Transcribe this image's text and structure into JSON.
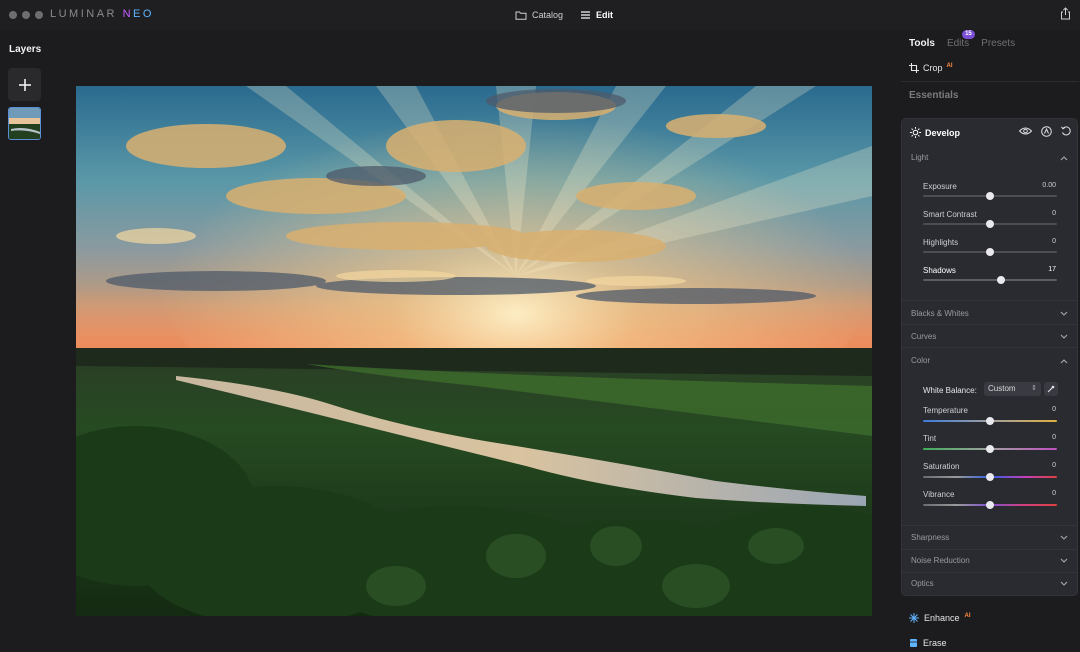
{
  "titlebar": {
    "brand_prefix": "LUMINAR",
    "brand_suffix": "NEO",
    "catalog_label": "Catalog",
    "edit_label": "Edit"
  },
  "left_panel": {
    "title": "Layers"
  },
  "right_panel": {
    "tabs": [
      {
        "label": "Tools",
        "active": true
      },
      {
        "label": "Edits",
        "active": false,
        "badge": "15"
      },
      {
        "label": "Presets",
        "active": false
      }
    ],
    "crop_label": "Crop",
    "ai_tag": "AI",
    "essentials_label": "Essentials",
    "develop": {
      "title": "Develop",
      "light_label": "Light",
      "light_sliders": [
        {
          "label": "Exposure",
          "value": "0.00",
          "position": 0.5
        },
        {
          "label": "Smart Contrast",
          "value": "0",
          "position": 0.5
        },
        {
          "label": "Highlights",
          "value": "0",
          "position": 0.5
        },
        {
          "label": "Shadows",
          "value": "17",
          "position": 0.585
        }
      ],
      "blacks_whites_label": "Blacks & Whites",
      "curves_label": "Curves",
      "color_label": "Color",
      "white_balance_label": "White Balance:",
      "white_balance_value": "Custom",
      "color_sliders": [
        {
          "label": "Temperature",
          "value": "0",
          "position": 0.5
        },
        {
          "label": "Tint",
          "value": "0",
          "position": 0.5
        },
        {
          "label": "Saturation",
          "value": "0",
          "position": 0.5
        },
        {
          "label": "Vibrance",
          "value": "0",
          "position": 0.5
        }
      ],
      "sharpness_label": "Sharpness",
      "noise_reduction_label": "Noise Reduction",
      "optics_label": "Optics"
    },
    "enhance_label": "Enhance",
    "erase_label": "Erase"
  },
  "colors": {
    "accent_purple": "#7b4fd6",
    "ai_orange": "#ff8a3d",
    "panel_bg": "#2a2b31"
  }
}
